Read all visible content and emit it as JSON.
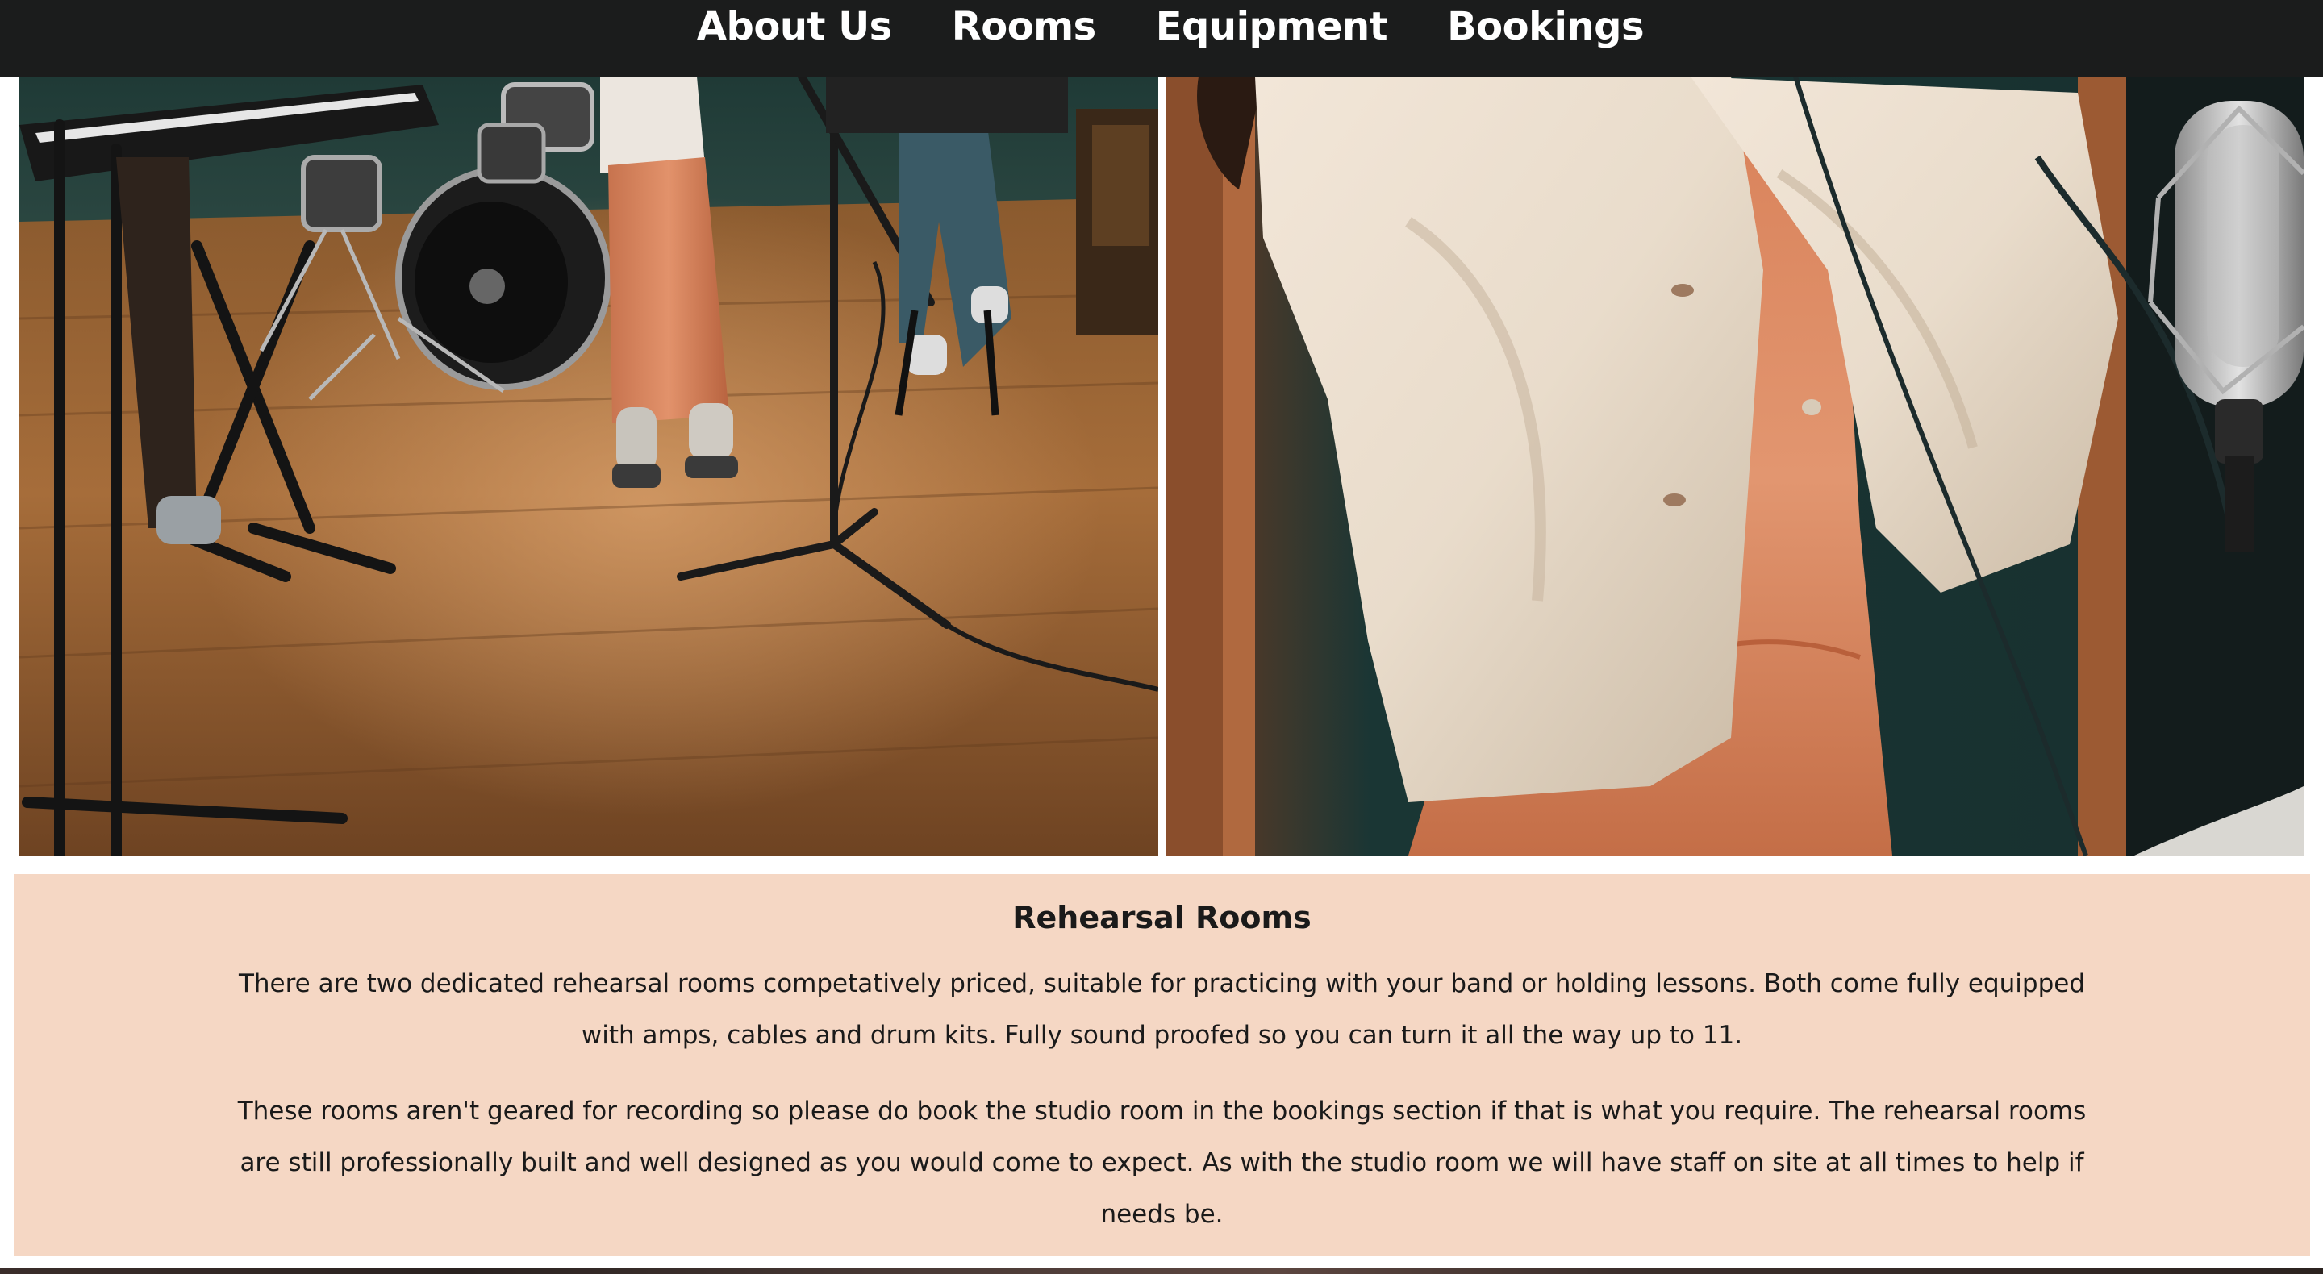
{
  "nav": {
    "items": [
      {
        "label": "About Us"
      },
      {
        "label": "Rooms"
      },
      {
        "label": "Equipment"
      },
      {
        "label": "Bookings"
      }
    ]
  },
  "photos": {
    "left": {
      "icon": "rehearsal-room-photo"
    },
    "right": {
      "icon": "studio-singer-photo"
    }
  },
  "rehearsal": {
    "title": "Rehearsal Rooms",
    "paragraph_1": "There are two dedicated rehearsal rooms competatively priced, suitable for practicing with your band or holding lessons. Both come fully equipped with amps, cables and drum kits. Fully sound proofed so you can turn it all the way up to 11.",
    "paragraph_2": "These rooms aren't geared for recording so please do book the studio room in the bookings section if that is what you require. The rehearsal rooms are still professionally built and well designed as you would come to expect. As with the studio room we will have staff on site at all times to help if needs be."
  },
  "colors": {
    "navbar_bg": "#1b1c1c",
    "panel_bg": "#f5d7c4",
    "text": "#1a1a1a"
  }
}
